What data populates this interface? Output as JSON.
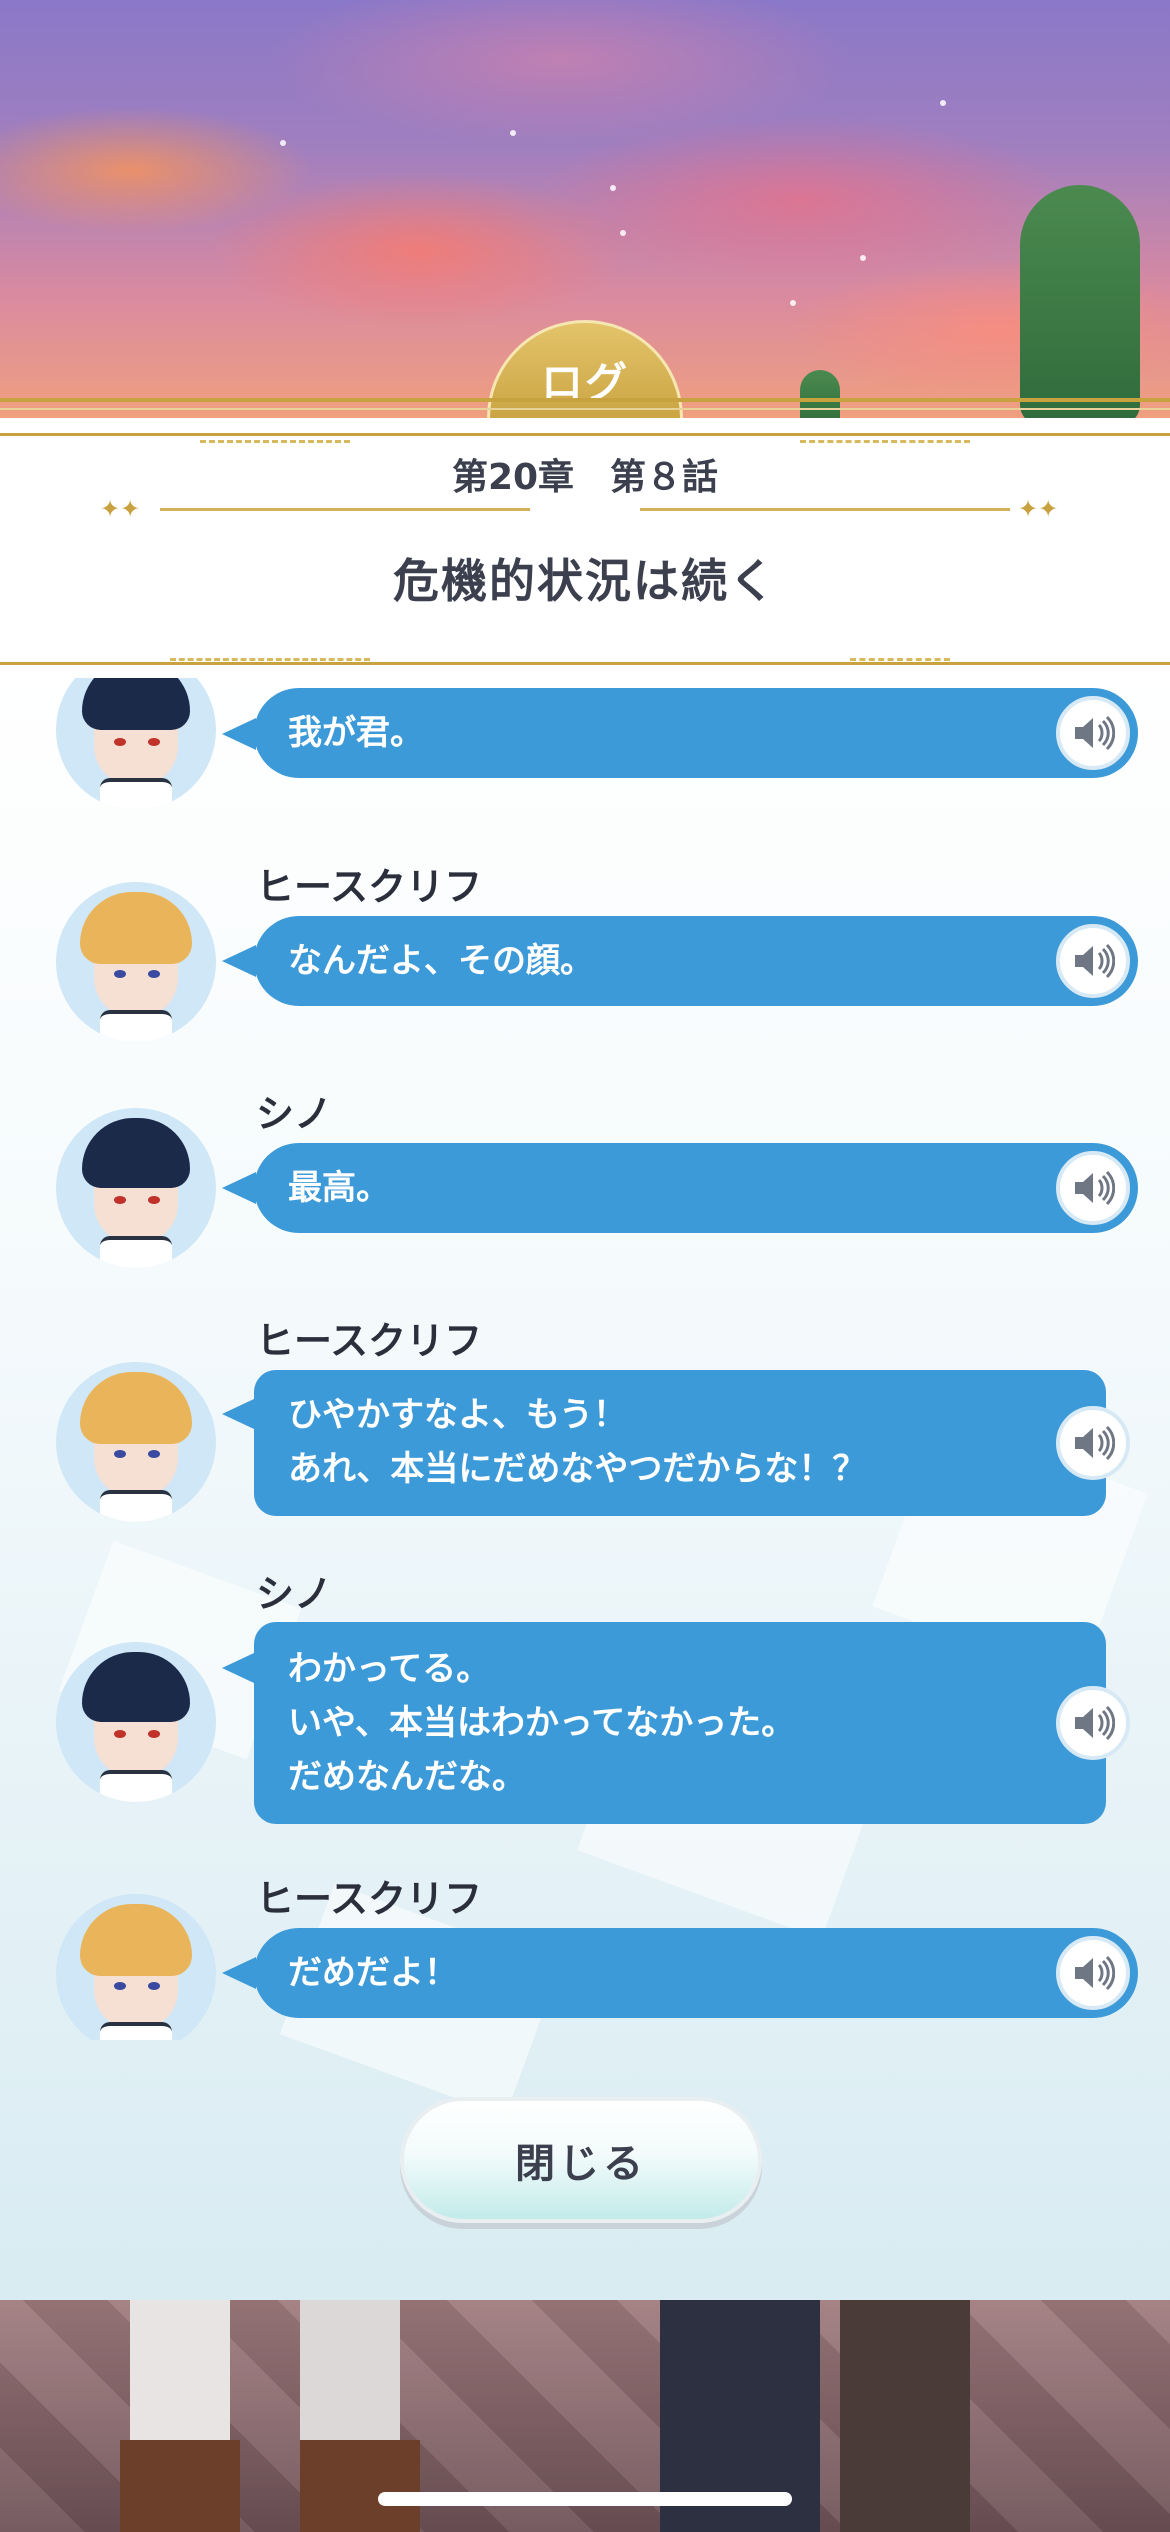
{
  "header": {
    "tab_label": "ログ",
    "chapter": "第20章　第８話",
    "episode_title": "危機的状況は続く"
  },
  "log": {
    "entries": [
      {
        "speaker": "",
        "avatar": "shino",
        "lines": [
          "我が君。"
        ]
      },
      {
        "speaker": "ヒースクリフ",
        "avatar": "heathcliff",
        "lines": [
          "なんだよ、その顔。"
        ]
      },
      {
        "speaker": "シノ",
        "avatar": "shino",
        "lines": [
          "最高。"
        ]
      },
      {
        "speaker": "ヒースクリフ",
        "avatar": "heathcliff",
        "lines": [
          "ひやかすなよ、もう！",
          "あれ、本当にだめなやつだからな！？"
        ]
      },
      {
        "speaker": "シノ",
        "avatar": "shino",
        "lines": [
          "わかってる。",
          "いや、本当はわかってなかった。",
          "だめなんだな。"
        ]
      },
      {
        "speaker": "ヒースクリフ",
        "avatar": "heathcliff",
        "lines": [
          "だめだよ！"
        ]
      }
    ],
    "voice_icon": "speaker-volume-icon"
  },
  "footer": {
    "close_label": "閉じる"
  },
  "colors": {
    "bubble": "#3d9ad8",
    "gold": "#c9a240",
    "text_dark": "#3b3f4e"
  }
}
